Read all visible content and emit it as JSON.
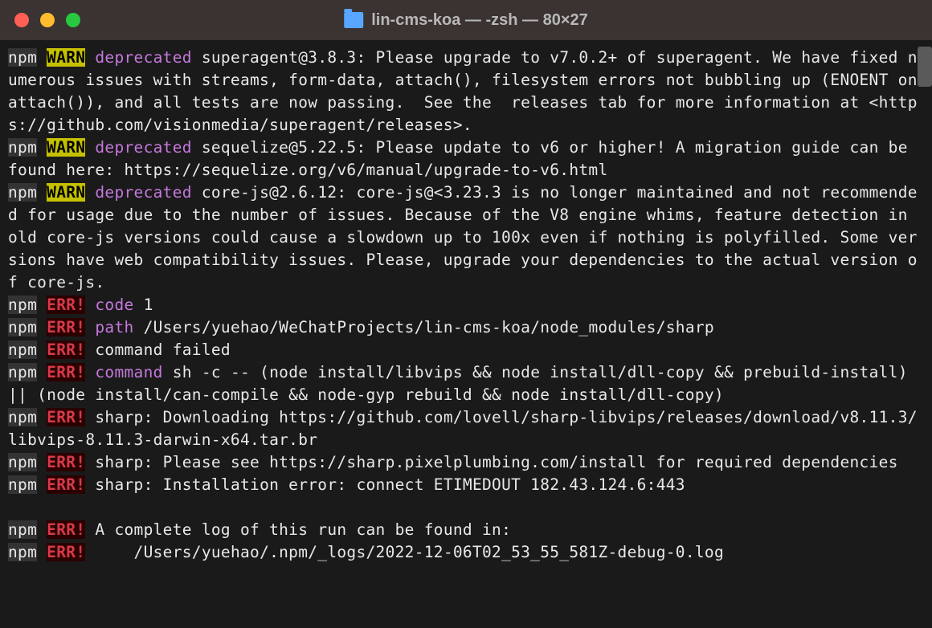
{
  "window": {
    "title": "lin-cms-koa — -zsh — 80×27"
  },
  "terminal": {
    "npm_label": "npm",
    "warn_label": "WARN",
    "err_label": "ERR!",
    "deprecated_label": "deprecated",
    "code_label": "code",
    "path_label": "path",
    "command_label": "command",
    "lines": {
      "warn1": " superagent@3.8.3: Please upgrade to v7.0.2+ of superagent. We have fixed numerous issues with streams, form-data, attach(), filesystem errors not bubbling up (ENOENT on attach()), and all tests are now passing.  See the  releases tab for more information at <https://github.com/visionmedia/superagent/releases>.",
      "warn2": " sequelize@5.22.5: Please update to v6 or higher! A migration guide can be found here: https://sequelize.org/v6/manual/upgrade-to-v6.html",
      "warn3": " core-js@2.6.12: core-js@<3.23.3 is no longer maintained and not recommended for usage due to the number of issues. Because of the V8 engine whims, feature detection in old core-js versions could cause a slowdown up to 100x even if nothing is polyfilled. Some versions have web compatibility issues. Please, upgrade your dependencies to the actual version of core-js.",
      "err_code": " 1",
      "err_path": " /Users/yuehao/WeChatProjects/lin-cms-koa/node_modules/sharp",
      "err_cmd_failed": " command failed",
      "err_command": " sh -c -- (node install/libvips && node install/dll-copy && prebuild-install) || (node install/can-compile && node-gyp rebuild && node install/dll-copy)",
      "err_sharp1": " sharp: Downloading https://github.com/lovell/sharp-libvips/releases/download/v8.11.3/libvips-8.11.3-darwin-x64.tar.br",
      "err_sharp2": " sharp: Please see https://sharp.pixelplumbing.com/install for required dependencies",
      "err_sharp3": " sharp: Installation error: connect ETIMEDOUT 182.43.124.6:443",
      "err_log1": " A complete log of this run can be found in:",
      "err_log2": "     /Users/yuehao/.npm/_logs/2022-12-06T02_53_55_581Z-debug-0.log"
    }
  }
}
